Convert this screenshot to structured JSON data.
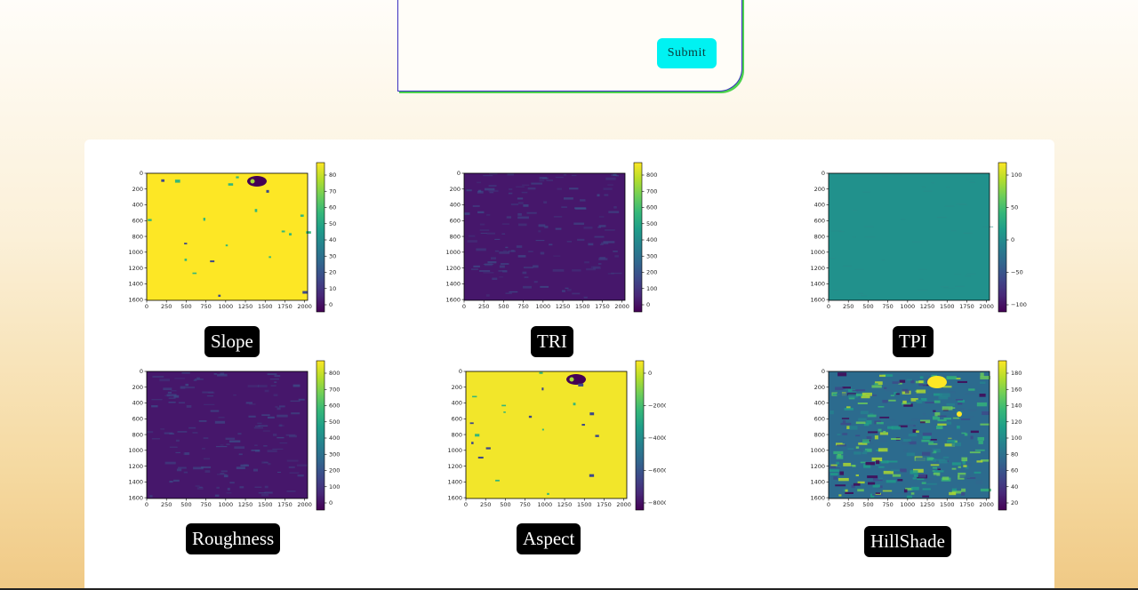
{
  "form": {
    "submit_label": "Submit"
  },
  "plots": [
    {
      "key": "slope",
      "label": "Slope",
      "kind": "slope",
      "cbar_ticks": [
        "80",
        "70",
        "60",
        "50",
        "40",
        "30",
        "20",
        "10",
        "0"
      ]
    },
    {
      "key": "tri",
      "label": "TRI",
      "kind": "rough",
      "cbar_ticks": [
        "800",
        "700",
        "600",
        "500",
        "400",
        "300",
        "200",
        "100",
        "0"
      ]
    },
    {
      "key": "tpi",
      "label": "TPI",
      "kind": "tpi",
      "cbar_ticks": [
        "100",
        "50",
        "0",
        "−50",
        "−100"
      ]
    },
    {
      "key": "roughness",
      "label": "Roughness",
      "kind": "rough",
      "cbar_ticks": [
        "800",
        "700",
        "600",
        "500",
        "400",
        "300",
        "200",
        "100",
        "0"
      ]
    },
    {
      "key": "aspect",
      "label": "Aspect",
      "kind": "aspect",
      "cbar_ticks": [
        "0",
        "−2000",
        "−4000",
        "−6000",
        "−8000"
      ]
    },
    {
      "key": "hillshade",
      "label": "HillShade",
      "kind": "hill",
      "cbar_ticks": [
        "180",
        "160",
        "140",
        "120",
        "100",
        "80",
        "60",
        "40",
        "20"
      ]
    }
  ],
  "axes": {
    "x_ticks": [
      "0",
      "250",
      "500",
      "750",
      "1000",
      "1250",
      "1500",
      "1750",
      "2000"
    ],
    "y_ticks": [
      "0",
      "200",
      "400",
      "600",
      "800",
      "1000",
      "1200",
      "1400",
      "1600"
    ]
  },
  "colors": {
    "viridis_yellow": "#fde725",
    "viridis_purple": "#440154",
    "viridis_teal": "#21918c",
    "accent_cyan": "#00f2f2"
  }
}
